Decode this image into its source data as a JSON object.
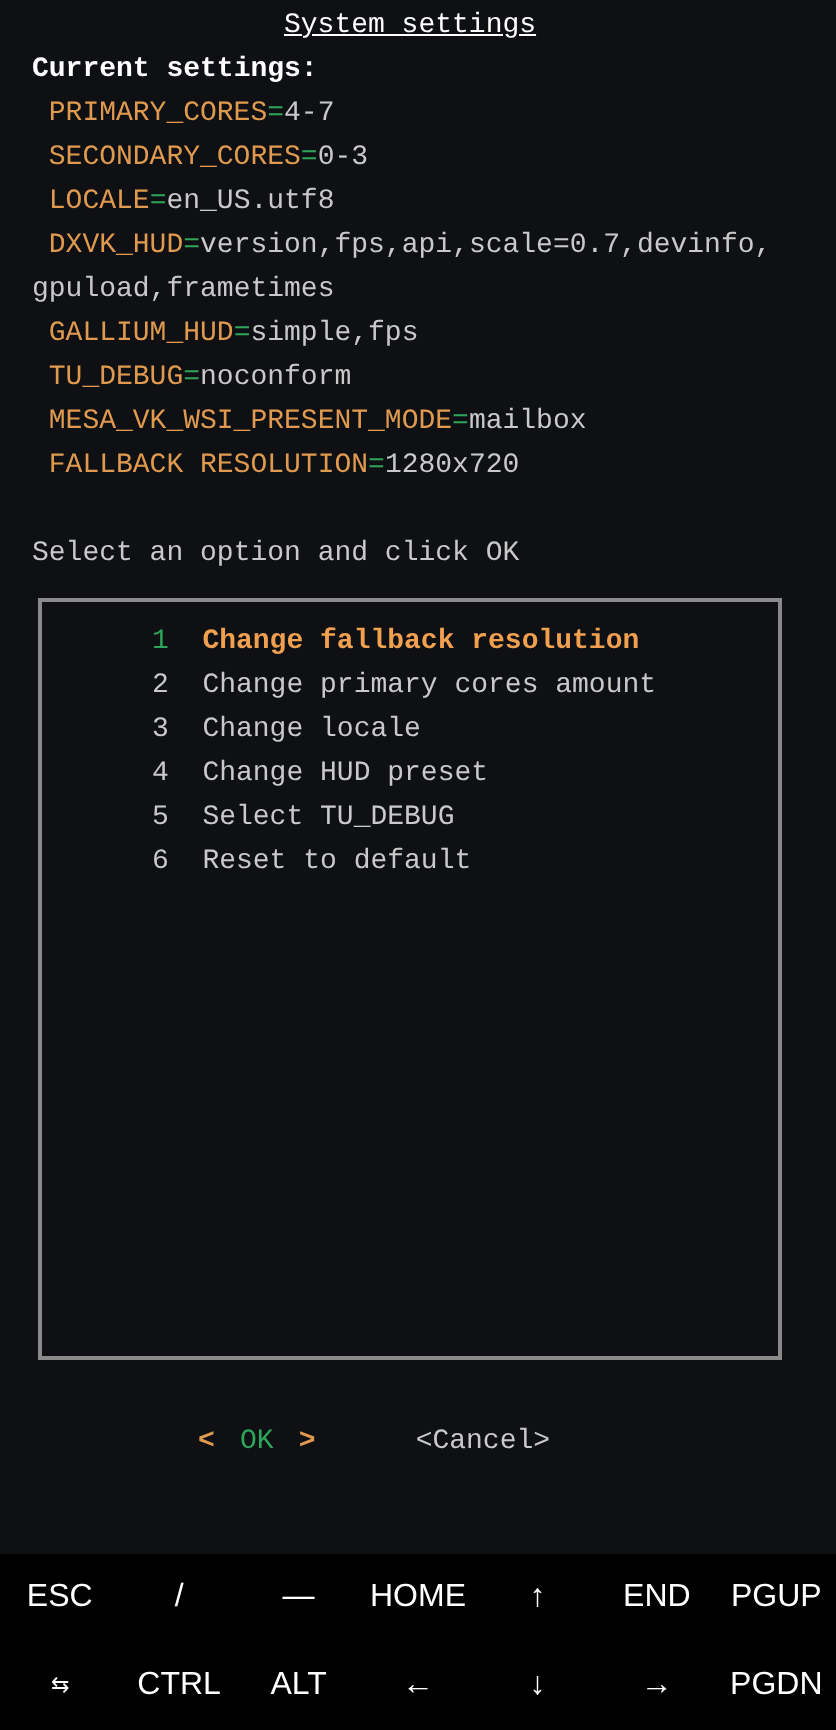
{
  "title": "System settings",
  "current_settings": {
    "heading": "Current settings:",
    "items": [
      {
        "key": "PRIMARY_CORES",
        "equals": "=",
        "value": "4-7"
      },
      {
        "key": "SECONDARY_CORES",
        "equals": "=",
        "value": "0-3"
      },
      {
        "key": "LOCALE",
        "equals": "=",
        "value": "en_US.utf8"
      },
      {
        "key": "DXVK_HUD",
        "equals": "=",
        "value": "version,fps,api,scale=0.7,devinfo,gpuload,frametimes"
      },
      {
        "key": "GALLIUM_HUD",
        "equals": "=",
        "value": "simple,fps"
      },
      {
        "key": "TU_DEBUG",
        "equals": "=",
        "value": "noconform"
      },
      {
        "key": "MESA_VK_WSI_PRESENT_MODE",
        "equals": "=",
        "value": "mailbox"
      },
      {
        "key": "FALLBACK RESOLUTION",
        "equals": "=",
        "value": "1280x720"
      }
    ]
  },
  "prompt": "Select an option and click OK",
  "menu": [
    {
      "number": "1",
      "label": "Change fallback resolution",
      "selected": true
    },
    {
      "number": "2",
      "label": "Change primary cores amount",
      "selected": false
    },
    {
      "number": "3",
      "label": "Change locale",
      "selected": false
    },
    {
      "number": "4",
      "label": "Change HUD preset",
      "selected": false
    },
    {
      "number": "5",
      "label": "Select TU_DEBUG",
      "selected": false
    },
    {
      "number": "6",
      "label": "Reset to default",
      "selected": false
    }
  ],
  "buttons": [
    {
      "label": "OK",
      "open": "<",
      "close": ">",
      "selected": true
    },
    {
      "label": "Cancel",
      "open": "<",
      "close": ">",
      "selected": false
    }
  ],
  "extra_keys": [
    [
      "ESC",
      "/",
      "—",
      "HOME",
      "↑",
      "END",
      "PGUP"
    ],
    [
      "⇆",
      "CTRL",
      "ALT",
      "←",
      "↓",
      "→",
      "PGDN"
    ]
  ]
}
